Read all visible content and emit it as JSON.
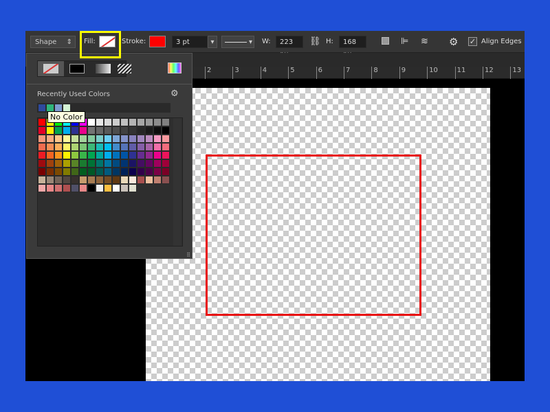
{
  "toolbar": {
    "mode": "Shape",
    "fill_label": "Fill:",
    "stroke_label": "Stroke:",
    "stroke_color": "#ff0000",
    "stroke_width": "3 pt",
    "w_label": "W:",
    "w_value": "223 px",
    "h_label": "H:",
    "h_value": "168 px",
    "align_edges": "Align Edges",
    "align_edges_checked": true,
    "highlight_color": "#ffff00"
  },
  "panel": {
    "tooltip": "No Color",
    "recent_label": "Recently Used Colors",
    "fill_types": [
      "no-color",
      "solid-color",
      "gradient",
      "pattern"
    ],
    "recent": [
      "#2e4a9e",
      "#2fb57a",
      "#7f9bd0",
      "#d5f5d5"
    ],
    "swatches": [
      [
        "#ff0000",
        "#ffff00",
        "#00ff00",
        "#00ffff",
        "#0000ff",
        "#ff00ff",
        "#ffffff",
        "#e6e6e6",
        "#d9d9d9",
        "#cccccc",
        "#bfbfbf",
        "#b3b3b3",
        "#a6a6a6",
        "#999999",
        "#8c8c8c",
        "#808080"
      ],
      [
        "#e60026",
        "#ffed00",
        "#00a651",
        "#00aeef",
        "#2e3192",
        "#ec008c",
        "#737373",
        "#666666",
        "#595959",
        "#4d4d4d",
        "#404040",
        "#333333",
        "#262626",
        "#1a1a1a",
        "#0d0d0d",
        "#000000"
      ],
      [
        "#f7977a",
        "#f9ad81",
        "#fdc68a",
        "#fff79a",
        "#c4df9b",
        "#a2d39c",
        "#82ca9d",
        "#7bcdc8",
        "#6ecff6",
        "#7ea7d8",
        "#8493ca",
        "#8882be",
        "#a187be",
        "#bc8dbf",
        "#f49ac2",
        "#f6989d"
      ],
      [
        "#f26c4f",
        "#f68e55",
        "#fbaf5c",
        "#fff467",
        "#acd372",
        "#7cc576",
        "#3bb878",
        "#1abbb4",
        "#00bff3",
        "#438ccb",
        "#5574b9",
        "#605ca8",
        "#855fa8",
        "#a763a8",
        "#f06ea9",
        "#f26d7d"
      ],
      [
        "#ed1c24",
        "#f26522",
        "#f7941d",
        "#fff200",
        "#8dc73f",
        "#39b54a",
        "#00a651",
        "#00a99d",
        "#00aeef",
        "#0072bc",
        "#0054a6",
        "#2e3192",
        "#662d91",
        "#92278f",
        "#ec008c",
        "#ed145b"
      ],
      [
        "#9e0b0f",
        "#a0410d",
        "#a36209",
        "#aba000",
        "#598527",
        "#1a7b30",
        "#007236",
        "#00746b",
        "#0076a3",
        "#004b80",
        "#003471",
        "#1b1464",
        "#440e62",
        "#630460",
        "#9e005d",
        "#9e0039"
      ],
      [
        "#790000",
        "#7b2e00",
        "#7d4900",
        "#827b00",
        "#406618",
        "#005e20",
        "#005826",
        "#005952",
        "#005b7f",
        "#003663",
        "#002157",
        "#0d004c",
        "#32004b",
        "#4b0049",
        "#7b0046",
        "#7a0026"
      ],
      [
        "#c7b299",
        "#998675",
        "#736357",
        "#534741",
        "#37302d",
        "#c69c6d",
        "#a67c52",
        "#8c6239",
        "#754c24",
        "#603913",
        "#e8d8b8",
        "#f8e8dc",
        "#a8504f",
        "#f0c0a0",
        "#c08070",
        "#8a5050"
      ],
      [
        "#f0a8a8",
        "#e88888",
        "#d07070",
        "#b05050",
        "#505068",
        "#e88888",
        "#000000",
        "#eeeeee",
        "#ffbf40",
        "#ffffff",
        "#c8c0b8",
        "#e0e0d0"
      ]
    ]
  },
  "ruler": [
    "2",
    "3",
    "4",
    "5",
    "6",
    "7",
    "8",
    "9",
    "10",
    "11",
    "12",
    "13"
  ]
}
